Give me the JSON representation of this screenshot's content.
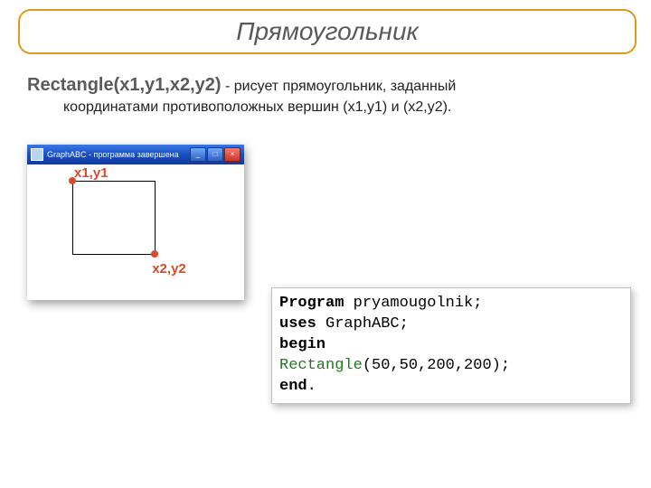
{
  "title": "Прямоугольник",
  "desc_strong": "Rectangle(x1,y1,x2,y2)",
  "desc_rest_1": " - рисует прямоугольник, заданный",
  "desc_rest_2": "координатами противоположных вершин (x1,y1) и (x2,y2).",
  "window": {
    "title": "GraphABC - программа завершена",
    "label1": "x1,y1",
    "label2": "x2,y2",
    "btn_min": "_",
    "btn_max": "□",
    "btn_close": "×"
  },
  "code": {
    "kw_program": "Program",
    "progname": " pryamougolnik;",
    "kw_uses": "uses",
    "unitname": " GraphABC;",
    "kw_begin": "begin",
    "indent": "   ",
    "fn": "Rectangle",
    "args": "(50,50,200,200);",
    "kw_end": "end",
    "dot": "."
  }
}
